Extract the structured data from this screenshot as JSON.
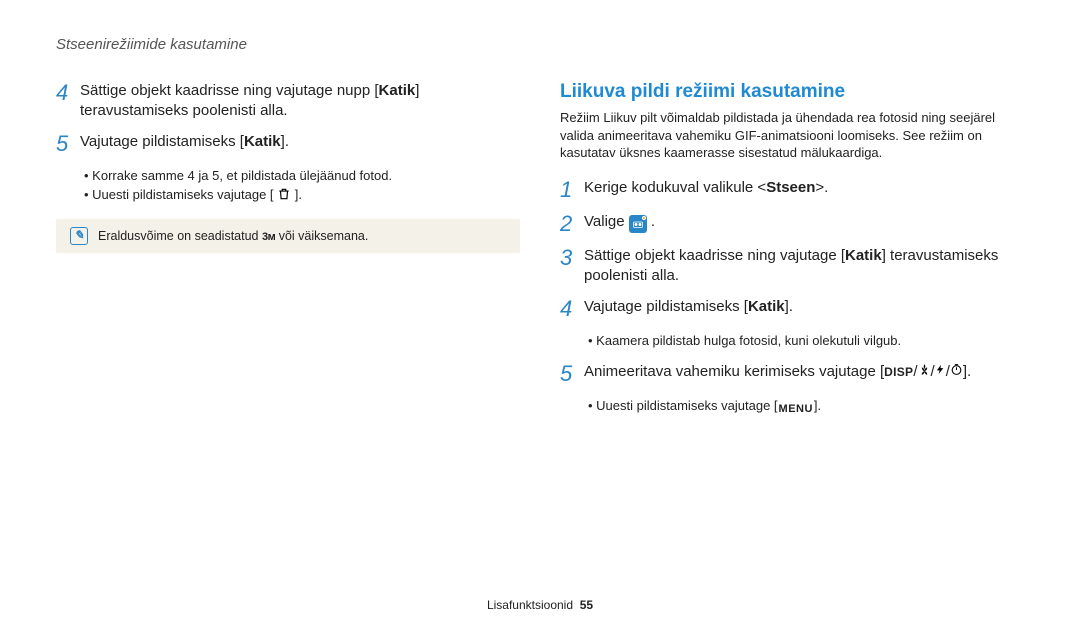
{
  "header": "Stseenirežiimide kasutamine",
  "left": {
    "step4_pre": "Sättige objekt kaadrisse ning vajutage nupp [",
    "step4_key": "Katik",
    "step4_post": "] teravustamiseks poolenisti alla.",
    "step5_pre": "Vajutage pildistamiseks [",
    "step5_key": "Katik",
    "step5_post": "].",
    "b1": "Korrake samme 4 ja 5, et pildistada ülejäänud fotod.",
    "b2_pre": "Uuesti pildistamiseks vajutage [ ",
    "b2_post": " ].",
    "note_pre": "Eraldusvõime on seadistatud ",
    "note_post": " või väiksemana."
  },
  "right": {
    "title": "Liikuva pildi režiimi kasutamine",
    "intro": "Režiim Liikuv pilt võimaldab pildistada ja ühendada rea fotosid ning seejärel valida animeeritava vahemiku GIF-animatsiooni loomiseks. See režiim on kasutatav üksnes kaamerasse sisestatud mälukaardiga.",
    "s1_pre": "Kerige kodukuval valikule <",
    "s1_key": "Stseen",
    "s1_post": ">.",
    "s2_pre": "Valige ",
    "s2_post": " .",
    "s3_pre": "Sättige objekt kaadrisse ning vajutage [",
    "s3_key": "Katik",
    "s3_post": "] teravustamiseks poolenisti alla.",
    "s4_pre": "Vajutage pildistamiseks [",
    "s4_key": "Katik",
    "s4_post": "].",
    "s4_b1": "Kaamera pildistab hulga fotosid, kuni olekutuli vilgub.",
    "s5_pre": "Animeeritava vahemiku kerimiseks vajutage [",
    "s5_post": "].",
    "s5_b1_pre": "Uuesti pildistamiseks vajutage [",
    "s5_b1_post": "]."
  },
  "footer": {
    "label": "Lisafunktsioonid",
    "page": "55"
  },
  "icons": {
    "disp": "DISP",
    "menu": "MENU",
    "three_m": "3ᴍ"
  }
}
